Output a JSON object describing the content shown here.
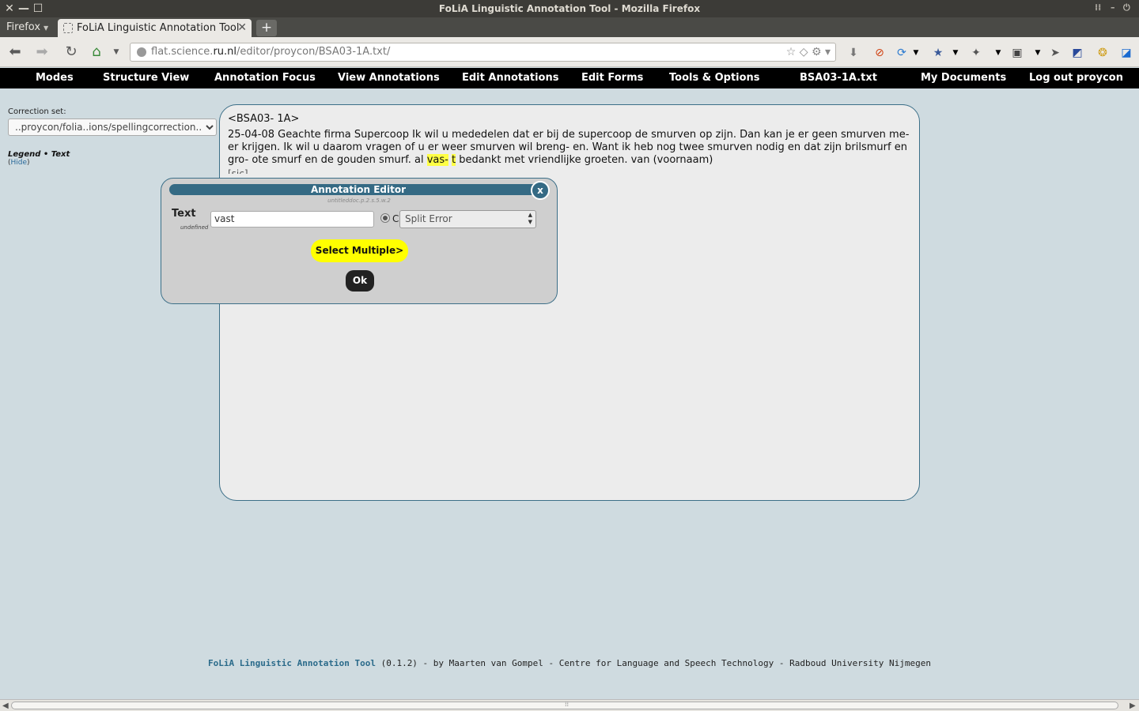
{
  "window": {
    "title": "FoLiA Linguistic Annotation Tool - Mozilla Firefox"
  },
  "browser": {
    "menu_label": "Firefox",
    "tab_title": "FoLiA Linguistic Annotation Tool",
    "url_host": "flat.science.",
    "url_domain": "ru.nl",
    "url_path": "/editor/proycon/BSA03-1A.txt/"
  },
  "menu": {
    "modes": "Modes",
    "structure_view": "Structure View",
    "annotation_focus": "Annotation Focus",
    "view_annotations": "View Annotations",
    "edit_annotations": "Edit Annotations",
    "edit_forms": "Edit Forms",
    "tools_options": "Tools & Options",
    "document_name": "BSA03-1A.txt",
    "my_documents": "My Documents",
    "logout": "Log out proycon"
  },
  "sidebar": {
    "correction_set_label": "Correction set:",
    "correction_set_value": "..proycon/folia..ions/spellingcorrection..",
    "legend": "Legend • Text",
    "hide_open": "(",
    "hide_link": "Hide",
    "hide_close": ")"
  },
  "document": {
    "heading": "<BSA03- 1A>",
    "text_before": "25-04-08 Geachte firma Supercoop Ik wil u mededelen dat er bij de supercoop de smurven op zijn. Dan kan je er geen smurven me- er krijgen. Ik wil u daarom vragen of u er weer smurven wil breng- en. Want ik heb nog twee smurven nodig en dat zijn brilsmurf en gro- ote smurf en de gouden smurf. al ",
    "highlight_1": "vas-",
    "highlight_2": "t",
    "text_after": " bedankt met vriendlijke groeten. van (voornaam)",
    "tail": "[sic]"
  },
  "editor": {
    "title": "Annotation Editor",
    "close": "x",
    "subtitle": "untitleddoc.p.2.s.5.w.2",
    "field_label": "Text",
    "field_sublabel": "undefined",
    "field_value": "vast",
    "radio_letter": "C",
    "correction_class": "Split Error",
    "select_multiple": "Select Multiple>",
    "ok": "Ok"
  },
  "footer": {
    "tool_name": "FoLiA Linguistic Annotation Tool",
    "rest": " (0.1.2) - by Maarten van Gompel - Centre for Language and Speech Technology - Radboud University Nijmegen"
  }
}
